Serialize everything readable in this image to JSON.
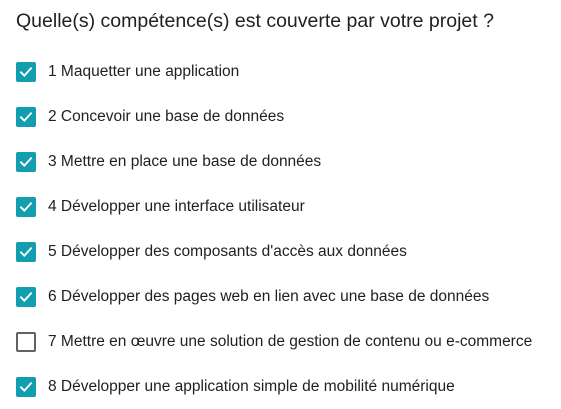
{
  "question": {
    "title": "Quelle(s) compétence(s) est couverte par votre projet ?"
  },
  "colors": {
    "checked": "#129eaf",
    "unchecked_border": "#5f6368",
    "text": "#202124"
  },
  "options": [
    {
      "label": "1 Maquetter une application",
      "checked": true,
      "icon": "check-icon"
    },
    {
      "label": "2 Concevoir une base de données",
      "checked": true,
      "icon": "check-icon"
    },
    {
      "label": "3 Mettre en place une base de données",
      "checked": true,
      "icon": "check-icon"
    },
    {
      "label": "4 Développer une interface utilisateur",
      "checked": true,
      "icon": "check-icon"
    },
    {
      "label": "5 Développer des composants d'accès aux données",
      "checked": true,
      "icon": "check-icon"
    },
    {
      "label": "6 Développer des pages web en lien avec une base de données",
      "checked": true,
      "icon": "check-icon"
    },
    {
      "label": "7 Mettre en œuvre une solution de gestion de contenu ou e-commerce",
      "checked": false,
      "icon": "check-icon"
    },
    {
      "label": "8 Développer une application simple de mobilité numérique",
      "checked": true,
      "icon": "check-icon"
    }
  ]
}
